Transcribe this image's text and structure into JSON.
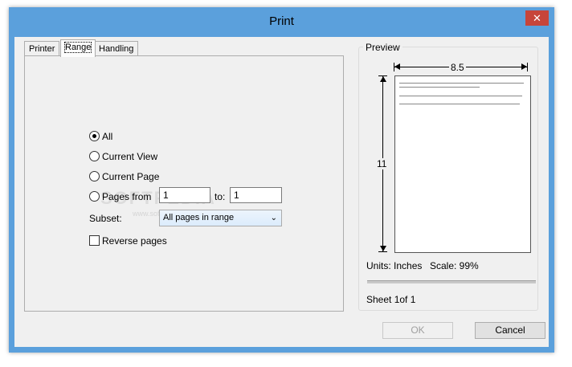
{
  "window": {
    "title": "Print",
    "close_glyph": "✕"
  },
  "tabs": [
    {
      "label": "Printer"
    },
    {
      "label": "Range"
    },
    {
      "label": "Handling"
    }
  ],
  "range": {
    "options": [
      {
        "label": "All",
        "checked": true
      },
      {
        "label": "Current View",
        "checked": false
      },
      {
        "label": "Current Page",
        "checked": false
      },
      {
        "label": "Pages from",
        "checked": false
      }
    ],
    "from_value": "1",
    "to_label": "to:",
    "to_value": "1",
    "subset_label": "Subset:",
    "subset_value": "All pages in range",
    "reverse_label": "Reverse pages",
    "reverse_checked": false
  },
  "watermark": {
    "text": "SOFTPEDIA",
    "sub": "www.softpedia.com"
  },
  "preview": {
    "legend": "Preview",
    "width_label": "8.5",
    "height_label": "11",
    "units_text": "Units: Inches",
    "scale_text": "Scale: 99%",
    "sheet_text": "Sheet 1of 1"
  },
  "buttons": {
    "ok": "OK",
    "cancel": "Cancel"
  },
  "colors": {
    "title_bar": "#5ba0dc",
    "close_button": "#c7453a",
    "dialog_bg": "#f0f0f0"
  }
}
